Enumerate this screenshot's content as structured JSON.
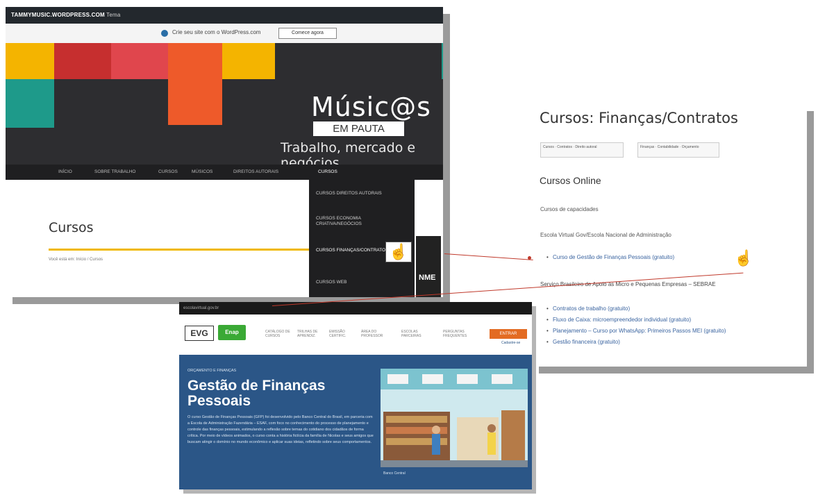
{
  "blog": {
    "admin_bar_site": "TAMMYMUSIC.WORDPRESS.COM",
    "admin_bar_extra": "Tema",
    "notice_text": "Crie seu site com o WordPress.com",
    "notice_button": "Comece agora",
    "brand": "Músic@s",
    "brand_sub": "EM PAUTA",
    "tagline": "Trabalho, mercado e negócios",
    "nav": [
      "INÍCIO",
      "SOBRE TRABALHO",
      "CURSOS",
      "MÚSICOS",
      "DIREITOS AUTORAIS",
      "CURSOS"
    ],
    "dropdown": [
      "CURSOS DIREITOS AUTORAIS",
      "CURSOS ECONOMIA CRIATIVA/NEGÓCIOS",
      "CURSOS FINANÇAS/CONTRATOS",
      "CURSOS WEB"
    ],
    "page_title": "Cursos",
    "breadcrumb": "Você está em: Início / Cursos",
    "side_label_1": "NME",
    "colors": {
      "yellow": "#f4b400",
      "red": "#d93a3a",
      "orange": "#ee5a2a",
      "teal": "#1e9a8a",
      "bar": "#f0b800"
    }
  },
  "courses": {
    "title": "Cursos: Finanças/Contratos",
    "chips": [
      "Cursos · Contratos · Direito autoral",
      "Finanças · Contabilidade · Orçamento"
    ],
    "section": "Cursos Online",
    "subsection": "Cursos de capacidades",
    "school": "Escola Virtual Gov/Escola Nacional de Administração",
    "featured_course": "Curso de Gestão de Finanças Pessoais (gratuito)",
    "sebrae_heading": "Serviço Brasileiro de Apoio às Micro e Pequenas Empresas – SEBRAE",
    "sebrae_courses": [
      "Contratos de trabalho (gratuito)",
      "Fluxo de Caixa: microempreendedor individual (gratuito)",
      "Planejamento – Curso por WhatsApp: Primeiros Passos MEI (gratuito)",
      "Gestão financeira (gratuito)"
    ]
  },
  "course_page": {
    "top_bar": "escolavirtual.gov.br",
    "logo_evg": "EVG",
    "logo_enap": "Enap",
    "nav": [
      "CATÁLOGO DE CURSOS",
      "TRILHAS DE APRENDIZ.",
      "EMISSÃO CERTIFIC.",
      "ÁREA DO PROFESSOR",
      "ESCOLAS PARCEIRAS",
      "PERGUNTAS FREQUENTES"
    ],
    "cta": "ENTRAR",
    "cta_sub": "Cadastre-se",
    "kicker": "ORÇAMENTO E FINANÇAS",
    "title": "Gestão de Finanças Pessoais",
    "description": "O curso Gestão de Finanças Pessoais (GFP) foi desenvolvido pelo Banco Central do Brasil, em parceria com a Escola de Administração Fazendária – ESAF, com foco no conhecimento do processo de planejamento e controle das finanças pessoais, estimulando a reflexão sobre temas do cotidiano dos cidadãos de forma crítica. Por meio de vídeos animados, o curso conta a história fictícia da família de Nicolas e seus amigos que buscam atingir o domínio no mundo econômico e aplicar suas ideias, refletindo sobre seus comportamentos.",
    "illustration_caption": "Banco Central",
    "hero_color": "#2b5687"
  }
}
